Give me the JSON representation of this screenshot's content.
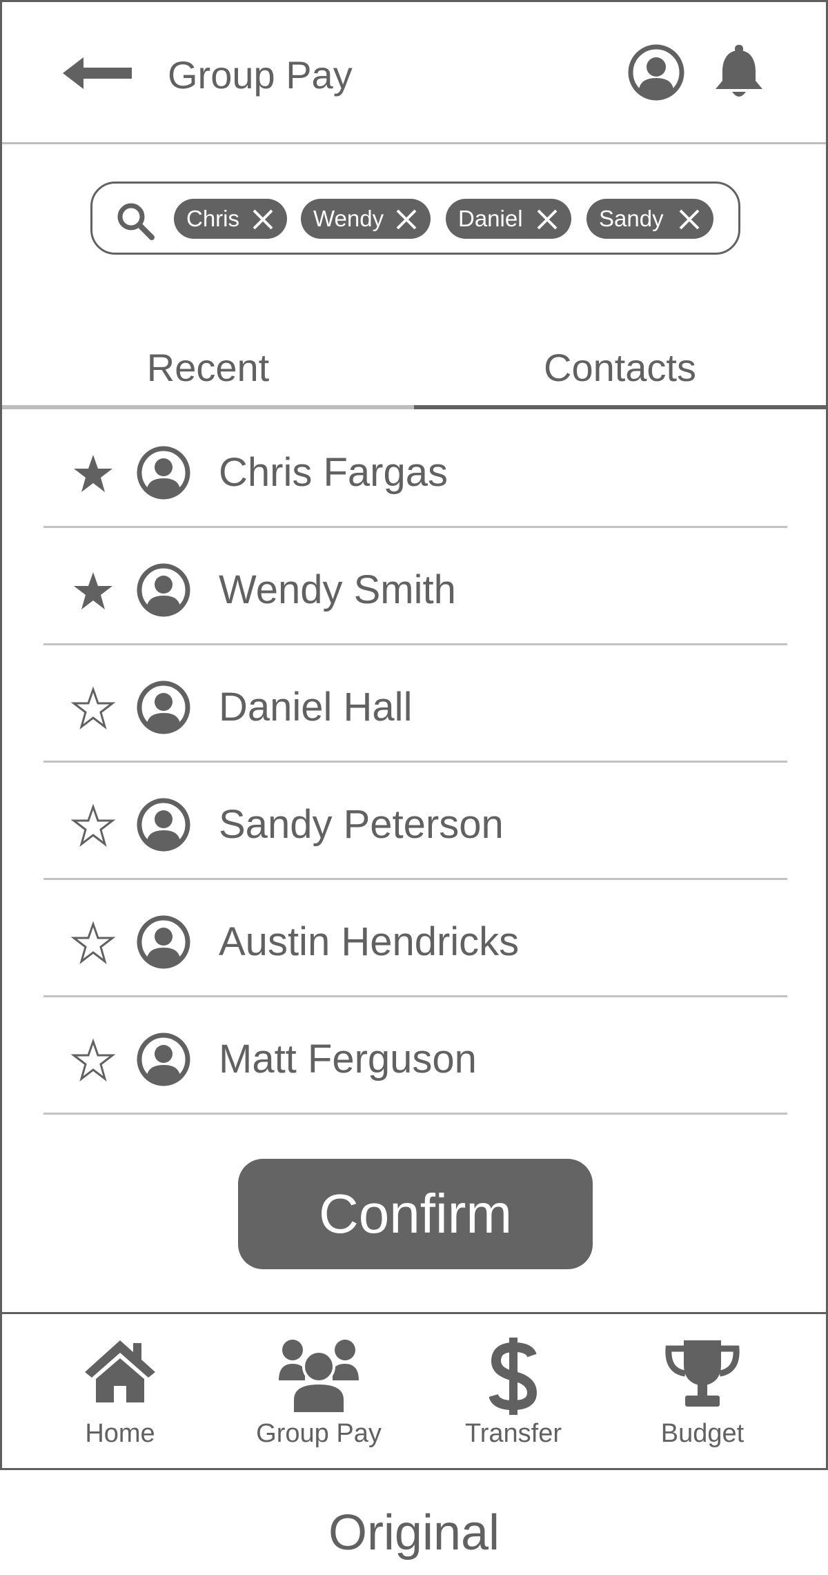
{
  "header": {
    "title": "Group Pay"
  },
  "search": {
    "chips": [
      "Chris",
      "Wendy",
      "Daniel",
      "Sandy"
    ]
  },
  "tabs": {
    "recent": "Recent",
    "contacts": "Contacts",
    "active": "Contacts"
  },
  "contacts": [
    {
      "name": "Chris Fargas",
      "favorite": true
    },
    {
      "name": "Wendy Smith",
      "favorite": true
    },
    {
      "name": "Daniel Hall",
      "favorite": false
    },
    {
      "name": "Sandy Peterson",
      "favorite": false
    },
    {
      "name": "Austin Hendricks",
      "favorite": false
    },
    {
      "name": "Matt Ferguson",
      "favorite": false
    }
  ],
  "confirm_label": "Confirm",
  "nav": [
    {
      "label": "Home",
      "icon": "home-icon"
    },
    {
      "label": "Group Pay",
      "icon": "group-icon"
    },
    {
      "label": "Transfer",
      "icon": "dollar-icon"
    },
    {
      "label": "Budget",
      "icon": "trophy-icon"
    }
  ],
  "caption": "Original",
  "colors": {
    "primary_gray": "#616161",
    "divider": "#c2c2c2",
    "chip_bg": "#626262"
  }
}
